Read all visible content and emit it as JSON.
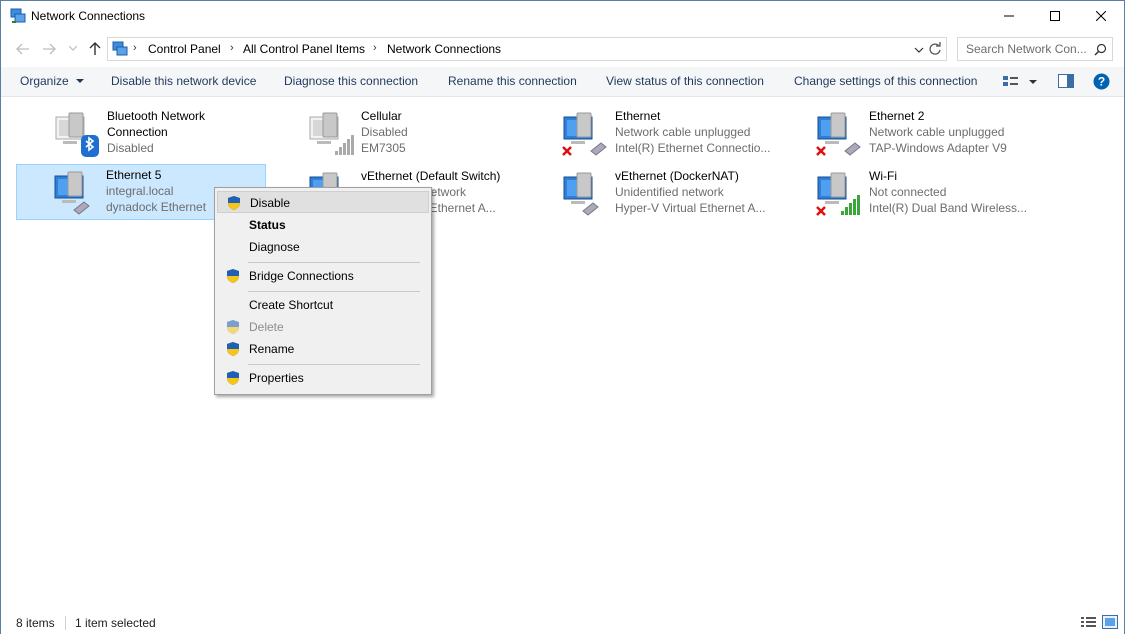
{
  "window": {
    "title": "Network Connections"
  },
  "address": {
    "crumbs": [
      "Control Panel",
      "All Control Panel Items",
      "Network Connections"
    ],
    "search_placeholder": "Search Network Con..."
  },
  "toolbar": {
    "organize": "Organize",
    "disable": "Disable this network device",
    "diagnose": "Diagnose this connection",
    "rename": "Rename this connection",
    "view_status": "View status of this connection",
    "change_settings": "Change settings of this connection"
  },
  "connections": [
    {
      "name": "Bluetooth Network",
      "name2": "Connection",
      "status": "Disabled",
      "device": "",
      "icon": "bluetooth-network-icon"
    },
    {
      "name": "Cellular",
      "status": "Disabled",
      "device": "EM7305",
      "icon": "cellular-network-icon"
    },
    {
      "name": "Ethernet",
      "status": "Network cable unplugged",
      "device": "Intel(R) Ethernet Connectio...",
      "icon": "ethernet-unplugged-icon"
    },
    {
      "name": "Ethernet 2",
      "status": "Network cable unplugged",
      "device": "TAP-Windows Adapter V9",
      "icon": "ethernet-unplugged-icon"
    },
    {
      "name": "Ethernet 5",
      "status": "integral.local",
      "device": "dynadock Ethernet",
      "icon": "ethernet-icon",
      "selected": true
    },
    {
      "name": "vEthernet (Default Switch)",
      "status": "network",
      "device": "al Ethernet A...",
      "icon": "ethernet-icon"
    },
    {
      "name": "vEthernet (DockerNAT)",
      "status": "Unidentified network",
      "device": "Hyper-V Virtual Ethernet A...",
      "icon": "ethernet-icon"
    },
    {
      "name": "Wi-Fi",
      "status": "Not connected",
      "device": "Intel(R) Dual Band Wireless...",
      "icon": "wifi-disconnected-icon"
    }
  ],
  "context_menu": {
    "items": [
      {
        "label": "Disable",
        "shield": true
      },
      {
        "label": "Status",
        "bold": true
      },
      {
        "label": "Diagnose"
      },
      {
        "label": "Bridge Connections",
        "shield": true
      },
      {
        "label": "Create Shortcut"
      },
      {
        "label": "Delete",
        "shield": true,
        "disabled": true
      },
      {
        "label": "Rename",
        "shield": true
      },
      {
        "label": "Properties",
        "shield": true
      }
    ]
  },
  "status": {
    "items_count": "8 items",
    "selected_count": "1 item selected"
  },
  "colors": {
    "selection_bg": "#cce8ff",
    "selection_border": "#99d1ff",
    "link_text": "#1e395b",
    "help_blue": "#0063b1"
  }
}
